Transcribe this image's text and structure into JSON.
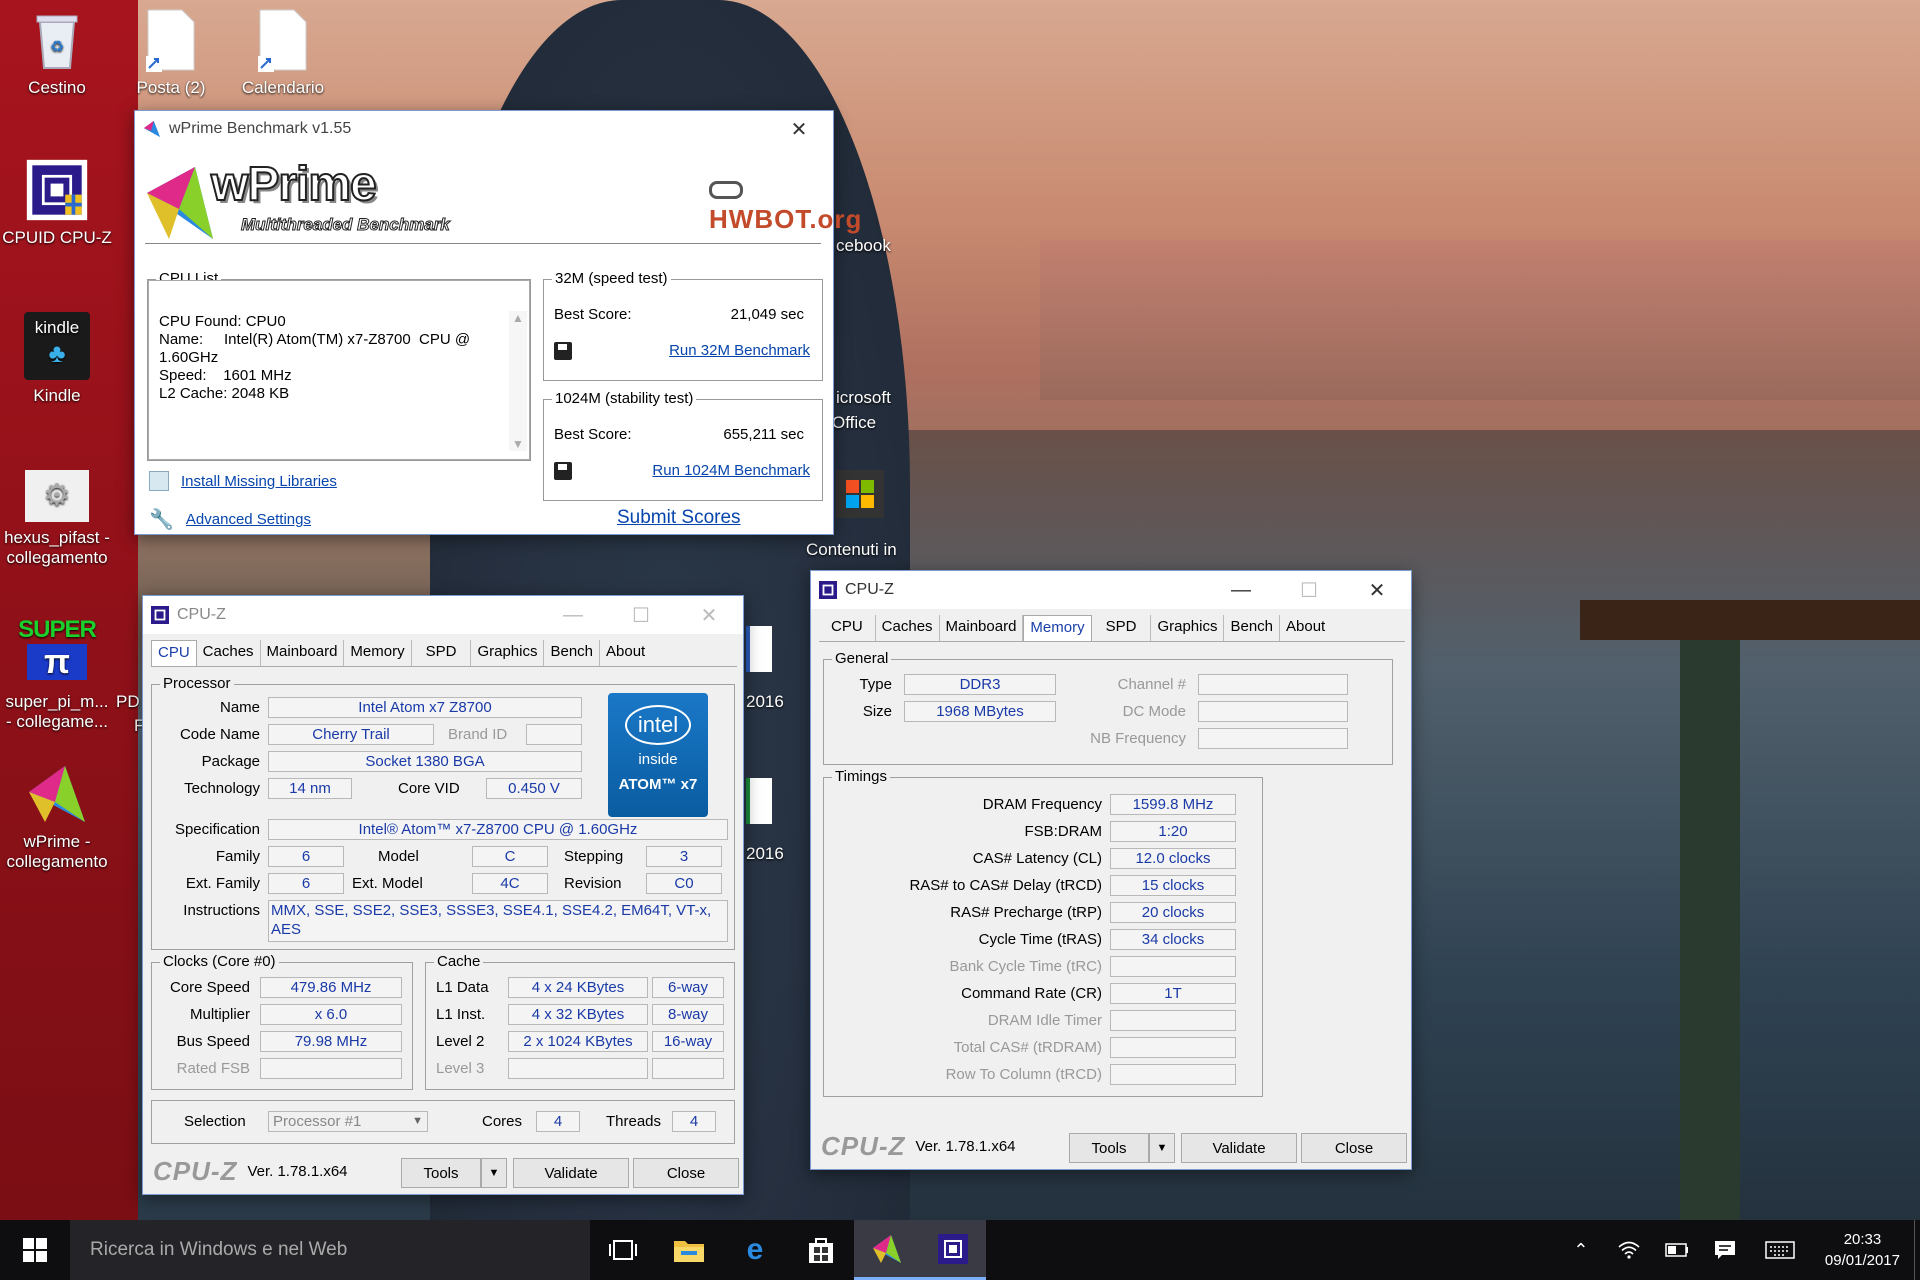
{
  "desktop": {
    "icons": [
      {
        "label": "Cestino"
      },
      {
        "label": "Posta (2)"
      },
      {
        "label": "Calendario"
      },
      {
        "label": "CPUID CPU-Z"
      },
      {
        "label": "Kindle"
      },
      {
        "label": "hexus_pifast - collegamento"
      },
      {
        "label": "super_pi_m... - collegame..."
      },
      {
        "label": "wPrime - collegamento"
      }
    ],
    "partials": {
      "facebook": "cebook",
      "office1": "icrosoft",
      "office2": "Office",
      "contenuti": "Contenuti in",
      "y2016a": "2016",
      "y2016b": "2016",
      "pd": "PD",
      "f": "F",
      "kindle_text": "kindle",
      "super_text": "SUPER"
    }
  },
  "wprime": {
    "title": "wPrime Benchmark v1.55",
    "logo_title": "wPrime",
    "logo_sub": "Multithreaded Benchmark",
    "hwbot": "HWBOT.org",
    "cpu_list_legend": "CPU List",
    "cpu_list": [
      "CPU Found: CPU0",
      "Name:     Intel(R) Atom(TM) x7-Z8700  CPU @",
      "1.60GHz",
      "Speed:    1601 MHz",
      "L2 Cache: 2048 KB"
    ],
    "speed_legend": "32M (speed test)",
    "speed_label": "Best Score:",
    "speed_value": "21,049 sec",
    "speed_run": "Run 32M Benchmark",
    "stab_legend": "1024M (stability test)",
    "stab_label": "Best Score:",
    "stab_value": "655,211 sec",
    "stab_run": "Run 1024M Benchmark",
    "install": "Install Missing Libraries",
    "advanced": "Advanced Settings",
    "submit": "Submit Scores"
  },
  "cpuz1": {
    "title": "CPU-Z",
    "tabs": [
      "CPU",
      "Caches",
      "Mainboard",
      "Memory",
      "SPD",
      "Graphics",
      "Bench",
      "About"
    ],
    "active_tab": "CPU",
    "processor_legend": "Processor",
    "name_label": "Name",
    "name": "Intel Atom x7 Z8700",
    "codename_label": "Code Name",
    "codename": "Cherry Trail",
    "brandid_label": "Brand ID",
    "brandid": "",
    "package_label": "Package",
    "package": "Socket 1380 BGA",
    "tech_label": "Technology",
    "tech": "14 nm",
    "corevid_label": "Core VID",
    "corevid": "0.450 V",
    "spec_label": "Specification",
    "spec": "Intel® Atom™ x7-Z8700  CPU @ 1.60GHz",
    "family_label": "Family",
    "family": "6",
    "model_label": "Model",
    "model": "C",
    "stepping_label": "Stepping",
    "stepping": "3",
    "extfamily_label": "Ext. Family",
    "extfamily": "6",
    "extmodel_label": "Ext. Model",
    "extmodel": "4C",
    "revision_label": "Revision",
    "revision": "C0",
    "instr_label": "Instructions",
    "instr1": "MMX, SSE, SSE2, SSE3, SSSE3, SSE4.1, SSE4.2, EM64T, VT-x,",
    "instr2": "AES",
    "intel_brand": "intel",
    "intel_inside": "inside",
    "intel_atom": "ATOM™ x7",
    "clocks_legend": "Clocks (Core #0)",
    "corespeed_label": "Core Speed",
    "corespeed": "479.86 MHz",
    "mult_label": "Multiplier",
    "mult": "x 6.0",
    "bus_label": "Bus Speed",
    "bus": "79.98 MHz",
    "fsb_label": "Rated FSB",
    "fsb": "",
    "cache_legend": "Cache",
    "l1d_label": "L1 Data",
    "l1d": "4 x 24 KBytes",
    "l1d_way": "6-way",
    "l1i_label": "L1 Inst.",
    "l1i": "4 x 32 KBytes",
    "l1i_way": "8-way",
    "l2_label": "Level 2",
    "l2": "2 x 1024 KBytes",
    "l2_way": "16-way",
    "l3_label": "Level 3",
    "l3": "",
    "l3_way": "",
    "selection_label": "Selection",
    "selection": "Processor #1",
    "cores_label": "Cores",
    "cores": "4",
    "threads_label": "Threads",
    "threads": "4",
    "brand": "CPU-Z",
    "ver": "Ver. 1.78.1.x64",
    "tools": "Tools",
    "validate": "Validate",
    "close": "Close"
  },
  "cpuz2": {
    "title": "CPU-Z",
    "tabs": [
      "CPU",
      "Caches",
      "Mainboard",
      "Memory",
      "SPD",
      "Graphics",
      "Bench",
      "About"
    ],
    "active_tab": "Memory",
    "general_legend": "General",
    "type_label": "Type",
    "type": "DDR3",
    "size_label": "Size",
    "size": "1968 MBytes",
    "channel_label": "Channel #",
    "dc_label": "DC Mode",
    "nb_label": "NB Frequency",
    "timings_legend": "Timings",
    "rows": [
      {
        "label": "DRAM Frequency",
        "value": "1599.8 MHz",
        "dim": false
      },
      {
        "label": "FSB:DRAM",
        "value": "1:20",
        "dim": false
      },
      {
        "label": "CAS# Latency (CL)",
        "value": "12.0 clocks",
        "dim": false
      },
      {
        "label": "RAS# to CAS# Delay (tRCD)",
        "value": "15 clocks",
        "dim": false
      },
      {
        "label": "RAS# Precharge (tRP)",
        "value": "20 clocks",
        "dim": false
      },
      {
        "label": "Cycle Time (tRAS)",
        "value": "34 clocks",
        "dim": false
      },
      {
        "label": "Bank Cycle Time (tRC)",
        "value": "",
        "dim": true
      },
      {
        "label": "Command Rate (CR)",
        "value": "1T",
        "dim": false
      },
      {
        "label": "DRAM Idle Timer",
        "value": "",
        "dim": true
      },
      {
        "label": "Total CAS# (tRDRAM)",
        "value": "",
        "dim": true
      },
      {
        "label": "Row To Column (tRCD)",
        "value": "",
        "dim": true
      }
    ],
    "brand": "CPU-Z",
    "ver": "Ver. 1.78.1.x64",
    "tools": "Tools",
    "validate": "Validate",
    "close": "Close"
  },
  "taskbar": {
    "search_placeholder": "Ricerca in Windows e nel Web",
    "time": "20:33",
    "date": "09/01/2017"
  }
}
